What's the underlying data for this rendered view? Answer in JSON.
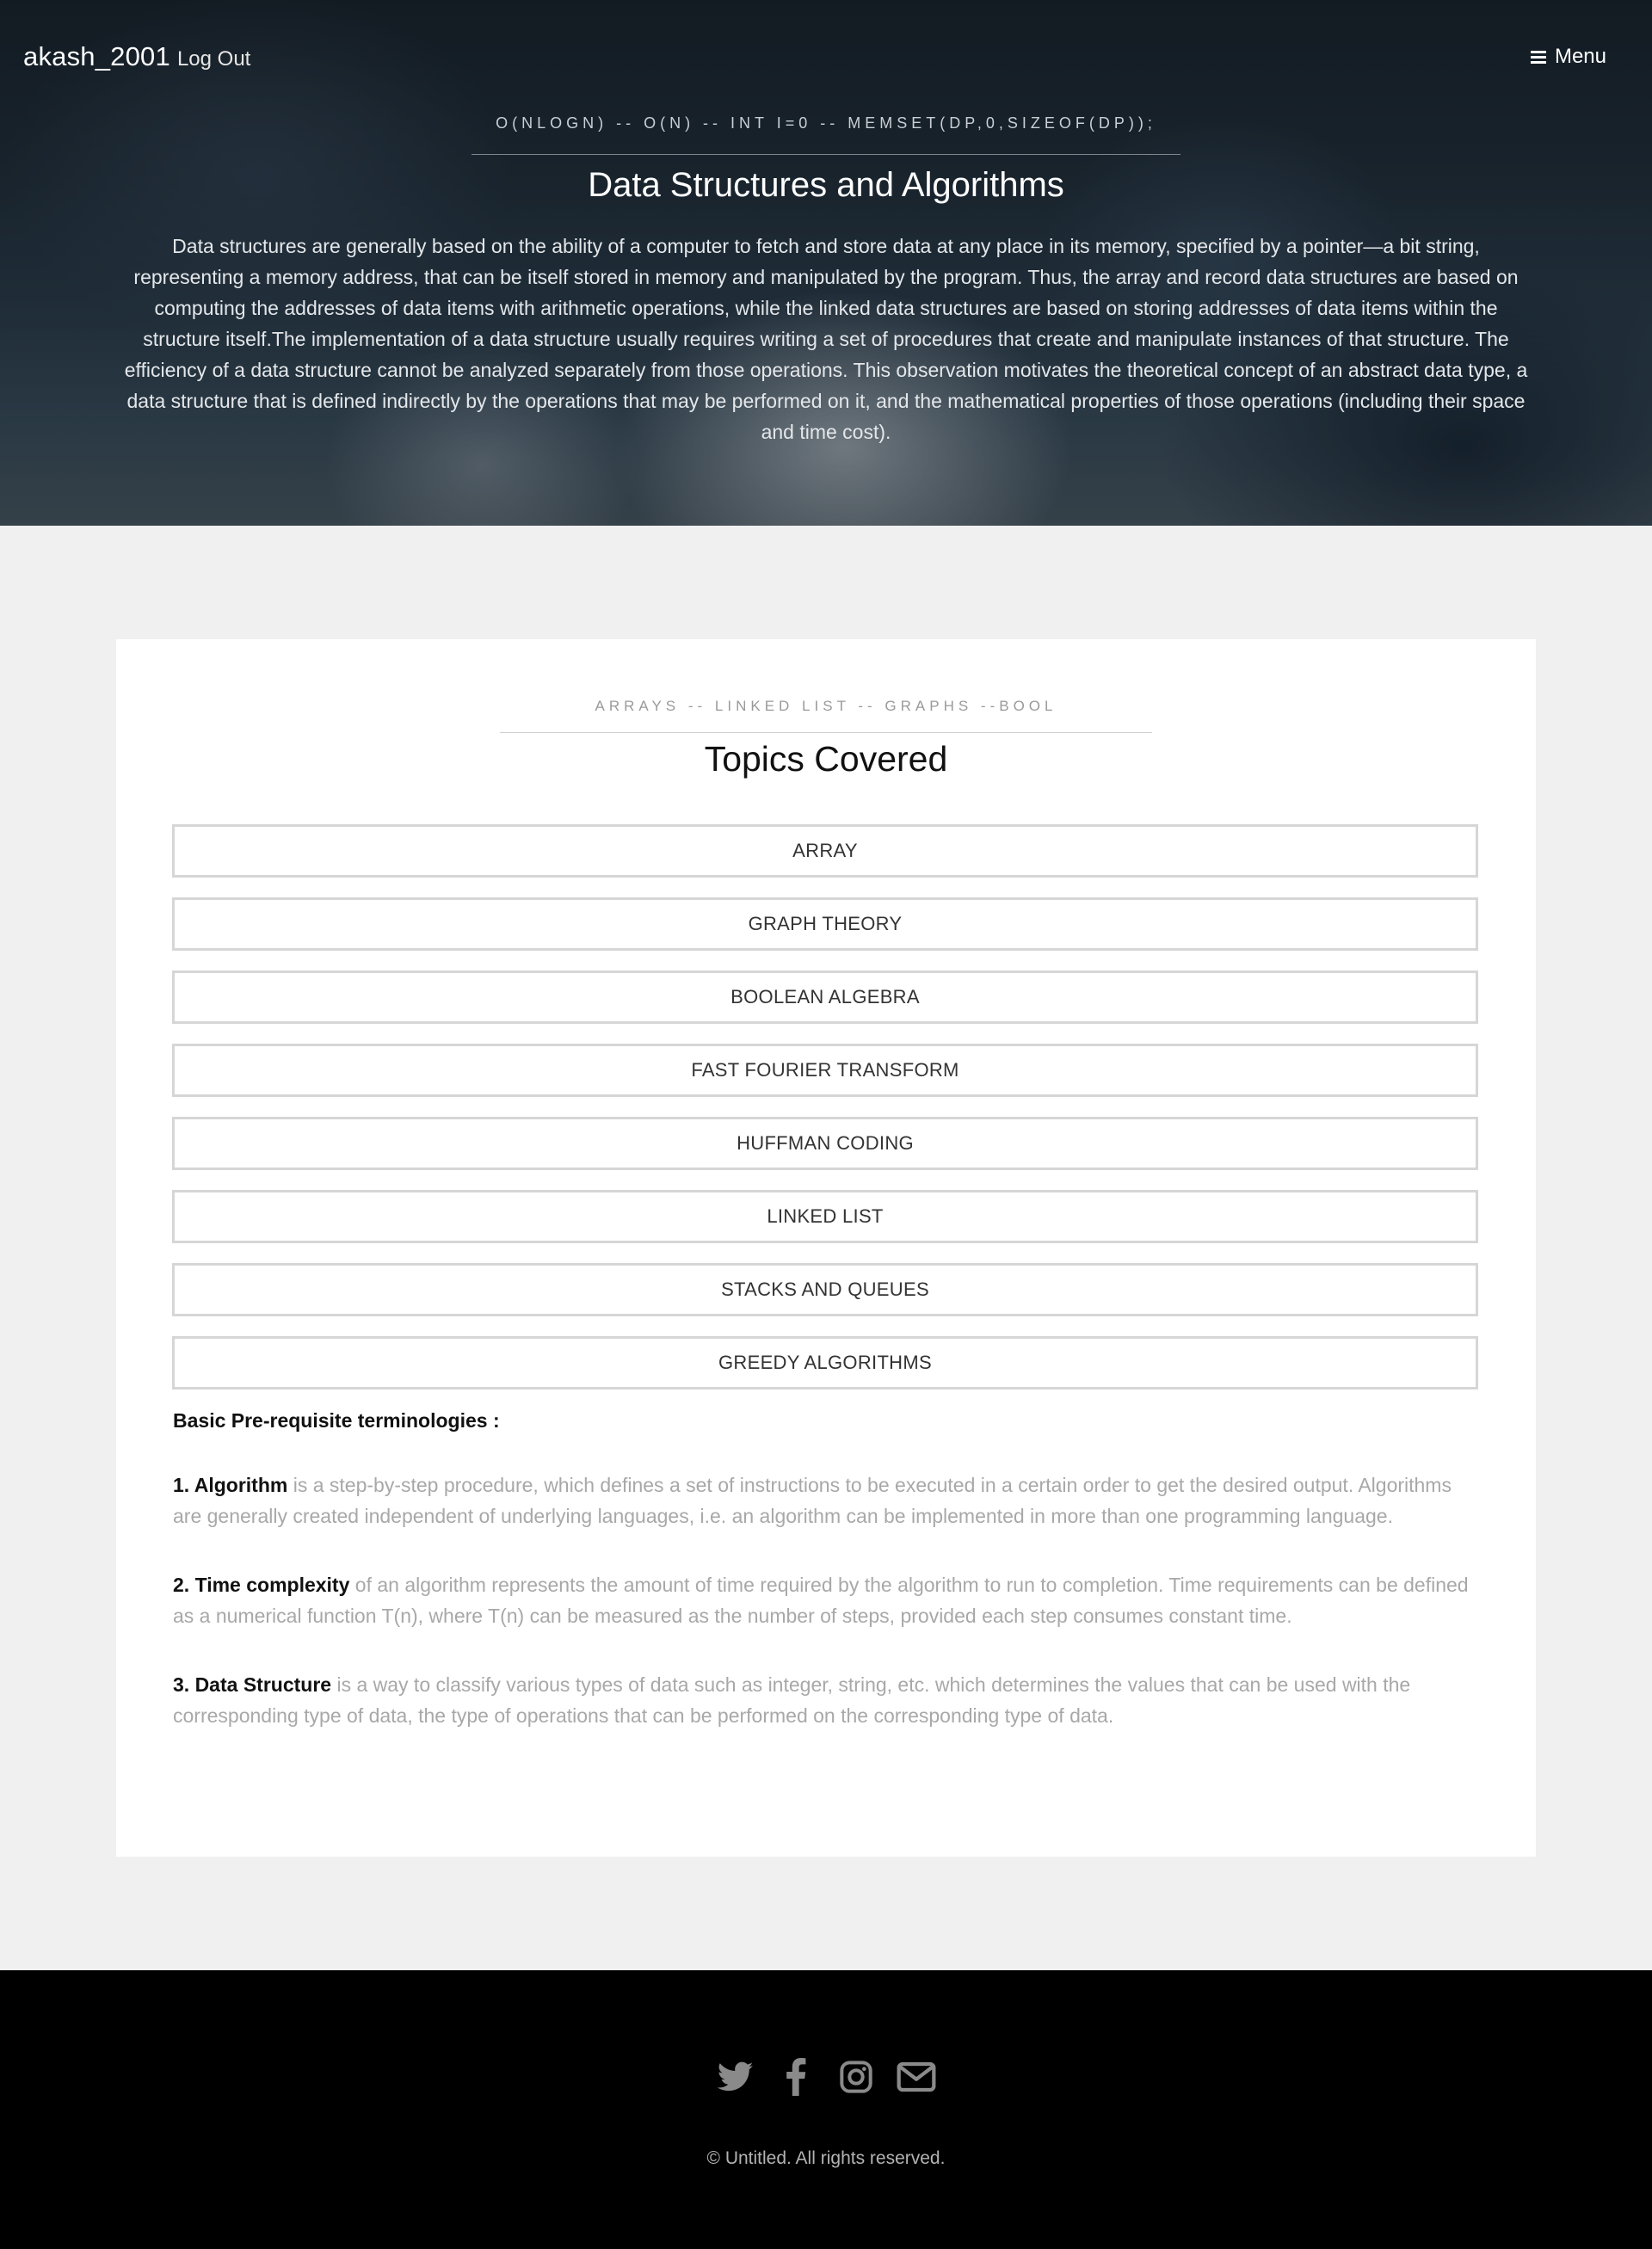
{
  "header": {
    "username": "akash_2001",
    "logout_label": "Log Out",
    "menu_label": "Menu"
  },
  "hero": {
    "subtitle": "O(NLOGN) -- O(N) -- INT I=0 -- MEMSET(DP,0,SIZEOF(DP));",
    "title": "Data Structures and Algorithms",
    "description": "Data structures are generally based on the ability of a computer to fetch and store data at any place in its memory, specified by a pointer—a bit string, representing a memory address, that can be itself stored in memory and manipulated by the program. Thus, the array and record data structures are based on computing the addresses of data items with arithmetic operations, while the linked data structures are based on storing addresses of data items within the structure itself.The implementation of a data structure usually requires writing a set of procedures that create and manipulate instances of that structure. The efficiency of a data structure cannot be analyzed separately from those operations. This observation motivates the theoretical concept of an abstract data type, a data structure that is defined indirectly by the operations that may be performed on it, and the mathematical properties of those operations (including their space and time cost)."
  },
  "topics": {
    "subtitle": "ARRAYS -- LINKED LIST -- GRAPHS --BOOL",
    "title": "Topics Covered",
    "items": [
      {
        "label": "ARRAY"
      },
      {
        "label": "GRAPH THEORY"
      },
      {
        "label": "BOOLEAN ALGEBRA"
      },
      {
        "label": "FAST FOURIER TRANSFORM"
      },
      {
        "label": "HUFFMAN CODING"
      },
      {
        "label": "LINKED LIST"
      },
      {
        "label": "STACKS AND QUEUES"
      },
      {
        "label": "GREEDY ALGORITHMS"
      }
    ]
  },
  "prereq": {
    "heading": "Basic Pre-requisite terminologies :",
    "terms": [
      {
        "name": "1. Algorithm",
        "text": " is a step-by-step procedure, which defines a set of instructions to be executed in a certain order to get the desired output. Algorithms are generally created independent of underlying languages, i.e. an algorithm can be implemented in more than one programming language."
      },
      {
        "name": "2. Time complexity",
        "text": " of an algorithm represents the amount of time required by the algorithm to run to completion. Time requirements can be defined as a numerical function T(n), where T(n) can be measured as the number of steps, provided each step consumes constant time."
      },
      {
        "name": "3. Data Structure",
        "text": " is a way to classify various types of data such as integer, string, etc. which determines the values that can be used with the corresponding type of data, the type of operations that can be performed on the corresponding type of data."
      }
    ]
  },
  "footer": {
    "social_icons": [
      "twitter-icon",
      "facebook-icon",
      "instagram-icon",
      "envelope-icon"
    ],
    "icon_color": "#8a8a8a",
    "copyright": "© Untitled. All rights reserved."
  }
}
